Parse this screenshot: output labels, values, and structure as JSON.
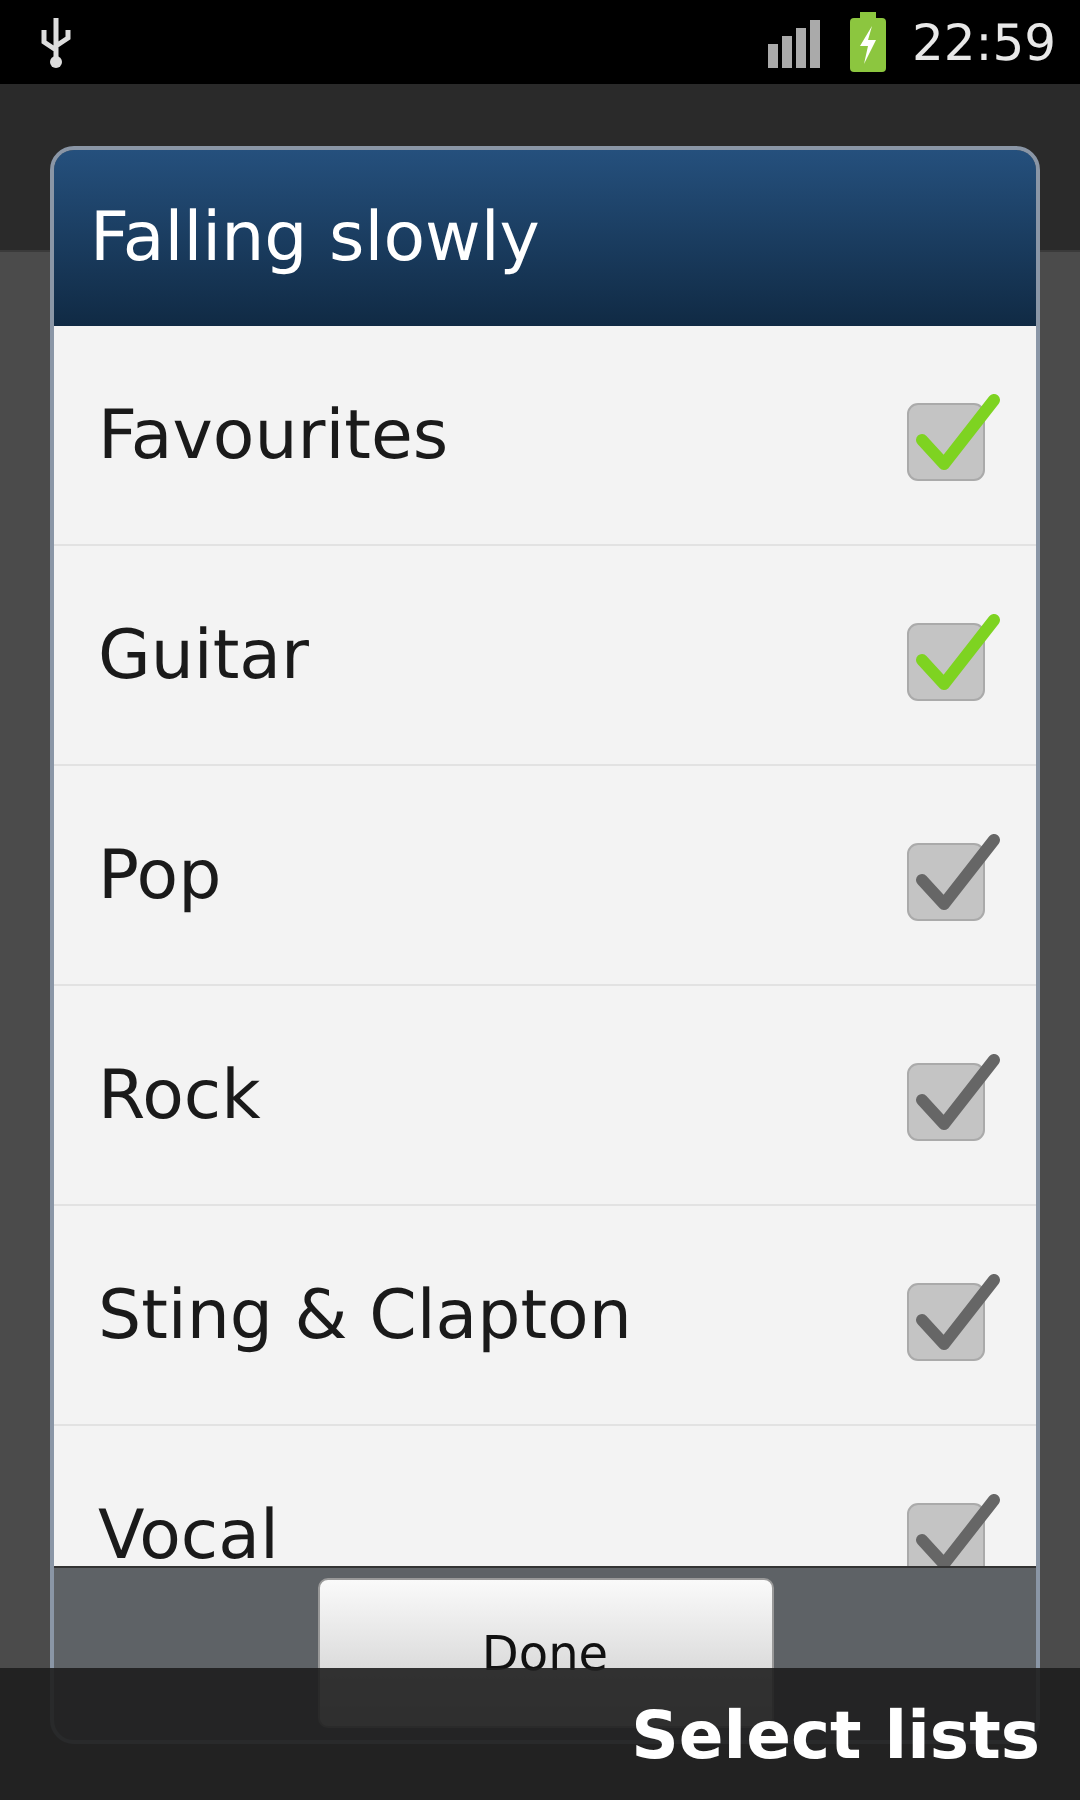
{
  "status_bar": {
    "time": "22:59"
  },
  "dialog": {
    "title": "Falling slowly",
    "items": [
      {
        "label": "Favourites",
        "checked": true
      },
      {
        "label": "Guitar",
        "checked": true
      },
      {
        "label": "Pop",
        "checked": false
      },
      {
        "label": "Rock",
        "checked": false
      },
      {
        "label": "Sting & Clapton",
        "checked": false
      },
      {
        "label": "Vocal",
        "checked": false
      }
    ],
    "button": "Done"
  },
  "toast": "Select lists"
}
